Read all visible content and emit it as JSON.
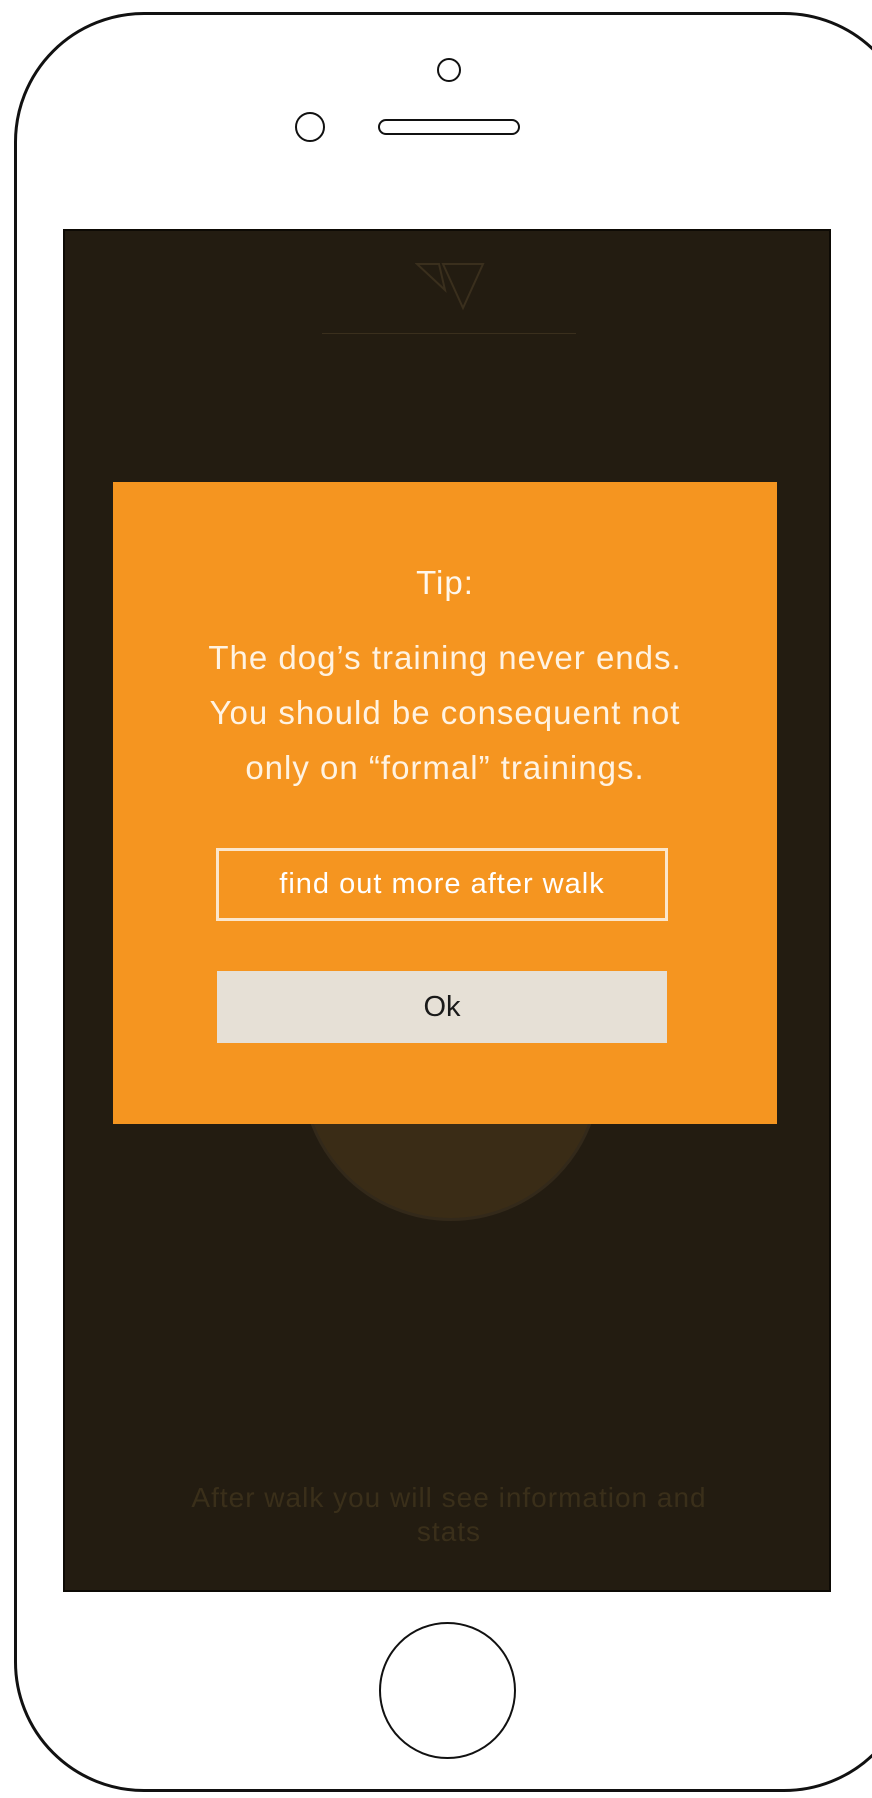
{
  "screen": {
    "background_color": "#231c11",
    "logo": {
      "icon": "down-triangles-logo-icon"
    },
    "start_button": {
      "icon": "circle-start-button"
    },
    "info_text": "After walk you will see information and stats"
  },
  "tip_dialog": {
    "background_color": "#f59520",
    "title": "Tip:",
    "body_lines": [
      "The dog’s training never ends.",
      "You should be consequent not",
      "only on “formal” trainings."
    ],
    "more_button_label": "find out more after walk",
    "ok_button_label": "Ok"
  }
}
